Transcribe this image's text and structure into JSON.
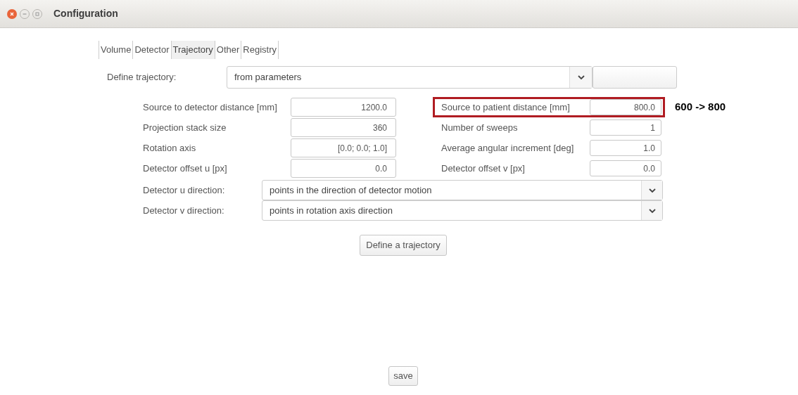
{
  "window": {
    "title": "Configuration"
  },
  "tabs": [
    {
      "label": "Volume",
      "selected": false
    },
    {
      "label": "Detector",
      "selected": false
    },
    {
      "label": "Trajectory",
      "selected": true
    },
    {
      "label": "Other",
      "selected": false
    },
    {
      "label": "Registry",
      "selected": false
    }
  ],
  "define_trajectory": {
    "label": "Define trajectory:",
    "value": "from parameters"
  },
  "parameter_rows": [
    {
      "left": {
        "label": "Source to detector distance [mm]",
        "value": "1200.0"
      },
      "right": {
        "label": "Source to patient distance [mm]",
        "value": "800.0",
        "highlighted": true,
        "note": "600 -> 800"
      }
    },
    {
      "left": {
        "label": "Projection stack size",
        "value": "360"
      },
      "right": {
        "label": "Number of sweeps",
        "value": "1",
        "highlighted": false
      }
    },
    {
      "left": {
        "label": "Rotation axis",
        "value": "[0.0; 0.0; 1.0]"
      },
      "right": {
        "label": "Average angular increment [deg]",
        "value": "1.0",
        "highlighted": false
      }
    },
    {
      "left": {
        "label": "Detector offset u [px]",
        "value": "0.0"
      },
      "right": {
        "label": "Detector offset v [px]",
        "value": "0.0",
        "highlighted": false
      }
    }
  ],
  "direction_rows": [
    {
      "label": "Detector u direction:",
      "value": "points in the direction of detector motion"
    },
    {
      "label": "Detector v direction:",
      "value": "points in rotation axis direction"
    }
  ],
  "buttons": {
    "define": "Define a trajectory",
    "save": "save"
  }
}
